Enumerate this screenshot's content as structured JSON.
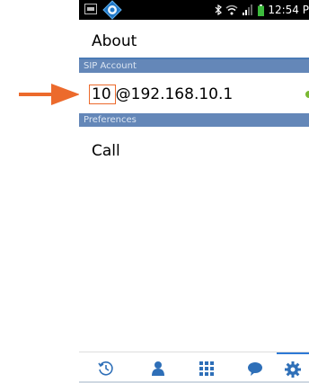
{
  "status_bar": {
    "time": "12:54 P"
  },
  "header": {
    "title": "About"
  },
  "sections": {
    "sip_account": "SIP Account",
    "preferences": "Preferences"
  },
  "sip_account": {
    "extension": "10",
    "host": "@192.168.10.1",
    "status_color": "#7ab833"
  },
  "preferences": {
    "call_label": "Call"
  },
  "colors": {
    "section_header": "#6487b8",
    "highlight": "#ec6a2c",
    "tab_icon": "#2e6fb8",
    "tab_active_indicator": "#2e7ad6"
  },
  "tabs": [
    {
      "icon": "history-icon",
      "active": false
    },
    {
      "icon": "contacts-icon",
      "active": false
    },
    {
      "icon": "dialpad-icon",
      "active": false
    },
    {
      "icon": "chat-icon",
      "active": false
    },
    {
      "icon": "settings-icon",
      "active": true
    }
  ]
}
